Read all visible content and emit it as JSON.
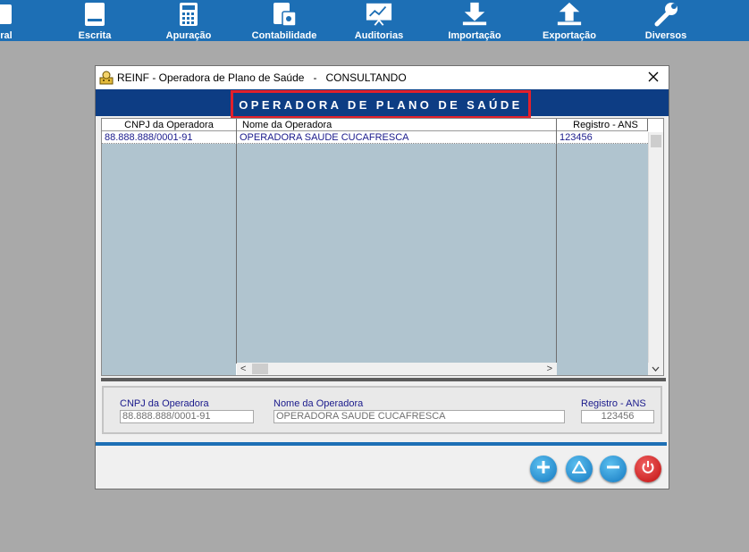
{
  "toolbar": {
    "items": [
      {
        "label": "ral",
        "icon": "doc-icon"
      },
      {
        "label": "Escrita",
        "icon": "book-icon"
      },
      {
        "label": "Apuração",
        "icon": "calculator-icon"
      },
      {
        "label": "Contabilidade",
        "icon": "ledger-calculator-icon"
      },
      {
        "label": "Auditorias",
        "icon": "chart-board-icon"
      },
      {
        "label": "Importação",
        "icon": "download-icon"
      },
      {
        "label": "Exportação",
        "icon": "upload-icon"
      },
      {
        "label": "Diversos",
        "icon": "wrench-icon"
      }
    ]
  },
  "dialog": {
    "title": "REINF - Operadora de Plano de Saúde   -   CONSULTANDO",
    "banner": "OPERADORA DE PLANO DE SAÚDE",
    "grid": {
      "columns": [
        "CNPJ da Operadora",
        "Nome da Operadora",
        "Registro - ANS"
      ],
      "rows": [
        {
          "cnpj": "88.888.888/0001-91",
          "nome": "OPERADORA SAUDE CUCAFRESCA",
          "registro": "123456"
        }
      ]
    },
    "detail": {
      "cnpj_label": "CNPJ da Operadora",
      "cnpj_value": "88.888.888/0001-91",
      "nome_label": "Nome da Operadora",
      "nome_value": "OPERADORA SAUDE CUCAFRESCA",
      "registro_label": "Registro - ANS",
      "registro_value": "123456"
    }
  },
  "colors": {
    "toolbar": "#1d6fb5",
    "banner": "#0d3d84",
    "highlight": "#e3202b",
    "grid_body": "#b0c4cf"
  }
}
